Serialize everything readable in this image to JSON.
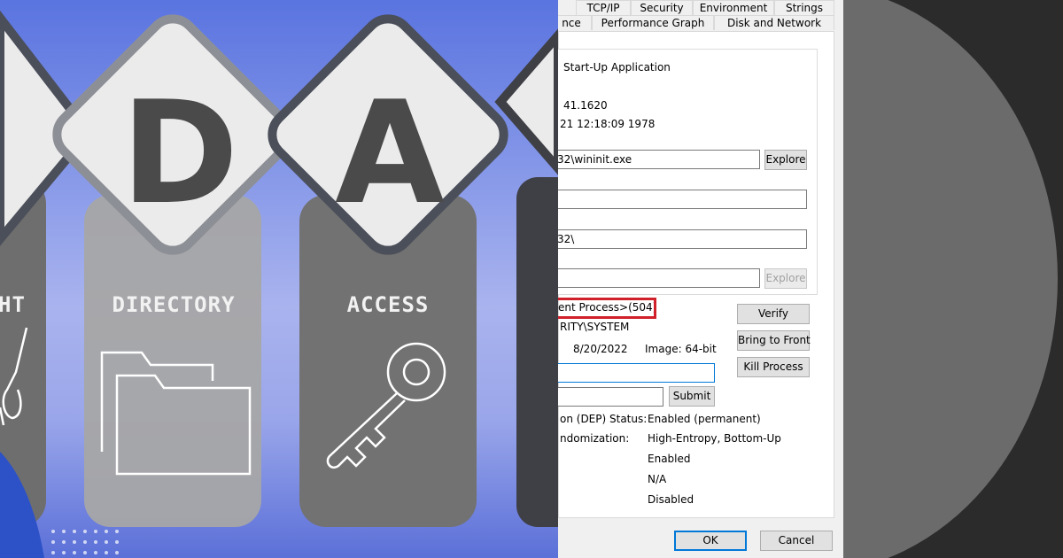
{
  "illustration": {
    "letters": [
      "D",
      "A"
    ],
    "labels": [
      "HT",
      "DIRECTORY",
      "ACCESS"
    ],
    "icons": [
      "figure-icon",
      "folder-icon",
      "key-icon"
    ]
  },
  "dialog": {
    "tabs_top": [
      "TCP/IP",
      "Security",
      "Environment",
      "Strings"
    ],
    "tabs_bottom": [
      "nce",
      "Performance Graph",
      "Disk and Network"
    ],
    "description": "Start-Up Application",
    "version": "41.1620",
    "time": "21 12:18:09 1978",
    "path_value": "32\\wininit.exe",
    "cmdline_value": "",
    "current_dir_value": "32\\",
    "autostart_value": "",
    "explore_label": "Explore",
    "parent_text": "ent Process>(504)",
    "user_text": "RITY\\SYSTEM",
    "started_date": "8/20/2022",
    "image_text": "Image: 64-bit",
    "verify_label": "Verify",
    "bring_label": "Bring to Front",
    "kill_label": "Kill Process",
    "comment_value": "",
    "vt_value": "",
    "submit_label": "Submit",
    "props": [
      {
        "label": "on (DEP) Status:",
        "value": "Enabled (permanent)"
      },
      {
        "label": "ndomization:",
        "value": "High-Entropy, Bottom-Up"
      },
      {
        "label": "",
        "value": "Enabled"
      },
      {
        "label": "",
        "value": "N/A"
      },
      {
        "label": "",
        "value": "Disabled"
      }
    ],
    "ok_label": "OK",
    "cancel_label": "Cancel"
  },
  "colors": {
    "highlight_red": "#d0202a",
    "focus_blue": "#0078d7",
    "letter_gray": "#4a4a4a"
  }
}
